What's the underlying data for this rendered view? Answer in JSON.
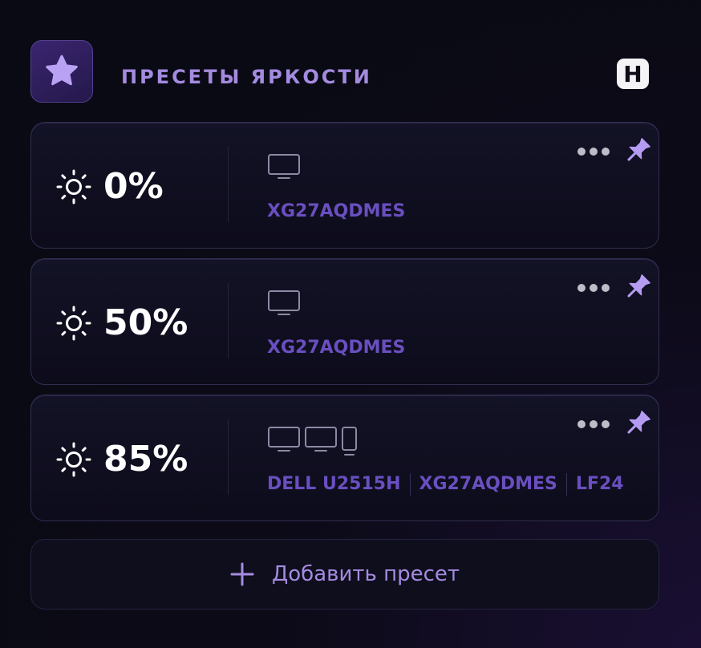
{
  "header": {
    "title": "ПРЕСЕТЫ ЯРКОСТИ",
    "badge_icon": "star-icon",
    "hotkey_icon": "letter-h-icon",
    "hotkey_label": "H"
  },
  "colors": {
    "accent": "#a48be0",
    "monitor_name": "#6a4fc0",
    "pin": "#b59cf2",
    "card_border": "#2f2e4f"
  },
  "presets": [
    {
      "brightness": "0%",
      "monitor_icons": [
        "monitor-icon"
      ],
      "monitors": [
        "XG27AQDMES"
      ]
    },
    {
      "brightness": "50%",
      "monitor_icons": [
        "monitor-icon"
      ],
      "monitors": [
        "XG27AQDMES"
      ]
    },
    {
      "brightness": "85%",
      "monitor_icons": [
        "monitor-icon",
        "monitor-icon",
        "portrait-monitor-icon"
      ],
      "monitors": [
        "DELL U2515H",
        "XG27AQDMES",
        "LF24"
      ]
    }
  ],
  "add_button": {
    "label": "Добавить пресет",
    "icon": "plus-icon"
  }
}
